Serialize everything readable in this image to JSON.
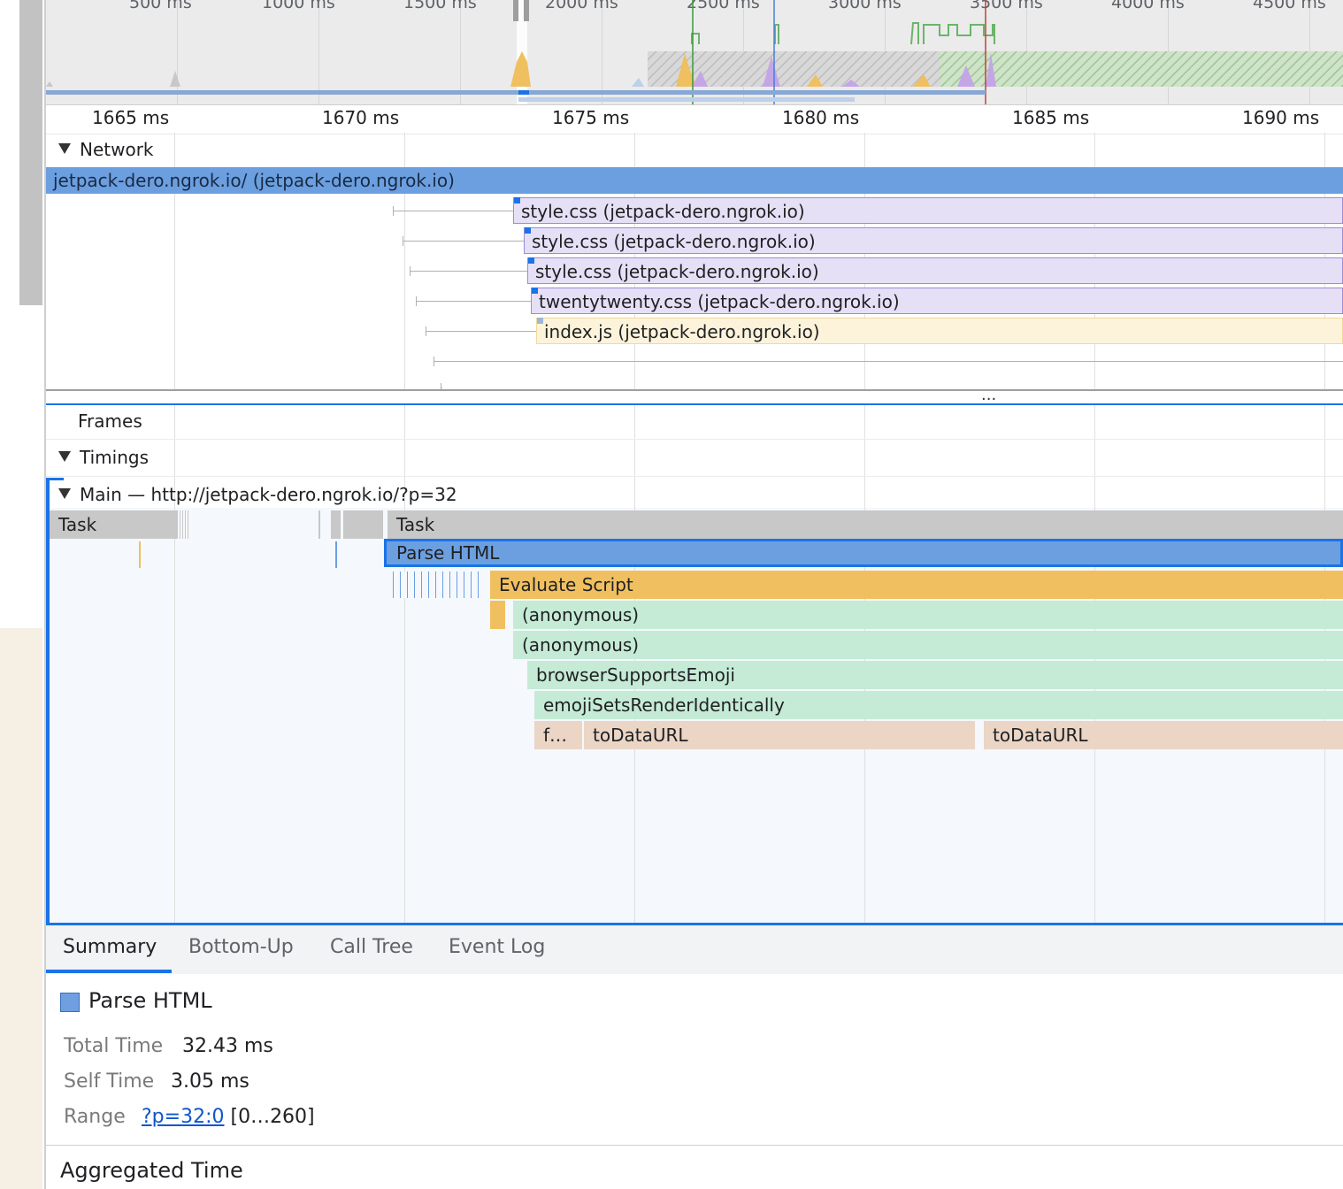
{
  "overview": {
    "time_labels": [
      "500 ms",
      "1000 ms",
      "1500 ms",
      "2000 ms",
      "2500 ms",
      "3000 ms",
      "3500 ms",
      "4000 ms",
      "4500 ms"
    ]
  },
  "ruler": {
    "labels": [
      "1665 ms",
      "1670 ms",
      "1675 ms",
      "1680 ms",
      "1685 ms",
      "1690 ms"
    ]
  },
  "network": {
    "title": "Network",
    "requests": [
      {
        "label": "jetpack-dero.ngrok.io/ (jetpack-dero.ngrok.io)",
        "type": "document"
      },
      {
        "label": "style.css (jetpack-dero.ngrok.io)",
        "type": "stylesheet"
      },
      {
        "label": "style.css (jetpack-dero.ngrok.io)",
        "type": "stylesheet"
      },
      {
        "label": "style.css (jetpack-dero.ngrok.io)",
        "type": "stylesheet"
      },
      {
        "label": "twentytwenty.css (jetpack-dero.ngrok.io)",
        "type": "stylesheet"
      },
      {
        "label": "index.js (jetpack-dero.ngrok.io)",
        "type": "script"
      }
    ]
  },
  "splitter": {
    "dots": "..."
  },
  "tracks": {
    "frames": "Frames",
    "timings": "Timings",
    "main": "Main — http://jetpack-dero.ngrok.io/?p=32"
  },
  "flame": {
    "task1": "Task",
    "task2": "Task",
    "parse_html": "Parse HTML",
    "evaluate_script": "Evaluate Script",
    "anonymous1": "(anonymous)",
    "anonymous2": "(anonymous)",
    "browser_supports_emoji": "browserSupportsEmoji",
    "emoji_sets": "emojiSetsRenderIdentically",
    "f_short": "f…",
    "to_data_url_1": "toDataURL",
    "to_data_url_2": "toDataURL"
  },
  "tabs": [
    "Summary",
    "Bottom-Up",
    "Call Tree",
    "Event Log"
  ],
  "summary": {
    "title": "Parse HTML",
    "swatch_color": "#6f9fe1",
    "total_time_label": "Total Time",
    "total_time_value": "32.43 ms",
    "self_time_label": "Self Time",
    "self_time_value": "3.05 ms",
    "range_label": "Range",
    "range_link": "?p=32:0",
    "range_extent": "[0…260]",
    "aggregated_title": "Aggregated Time"
  },
  "colors": {
    "document": "#6b9fe0",
    "stylesheet": "#e6e0f6",
    "script": "#fcf3da",
    "task": "#c8c8c8",
    "parse_html": "#6b9fe0",
    "evaluate_script": "#f0c060",
    "js_frame": "#c5ebd6",
    "native": "#ebd5c5",
    "selection": "#1a73e8"
  }
}
